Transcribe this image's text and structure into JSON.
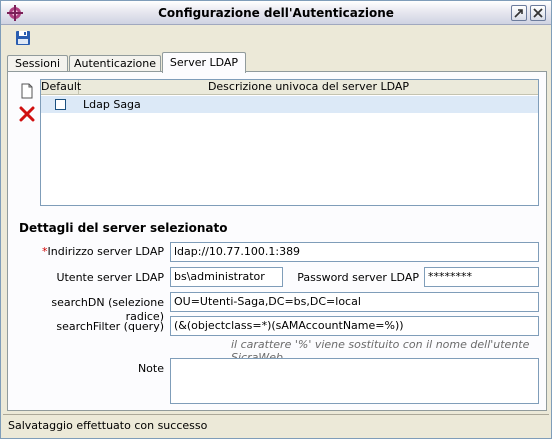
{
  "window": {
    "title": "Configurazione dell'Autenticazione"
  },
  "tabs": [
    {
      "label": "Sessioni"
    },
    {
      "label": "Autenticazione"
    },
    {
      "label": "Server LDAP",
      "active": true
    }
  ],
  "grid": {
    "columns": [
      "Default",
      "Descrizione univoca del server LDAP"
    ],
    "rows": [
      {
        "default": false,
        "description": "Ldap Saga"
      }
    ]
  },
  "details": {
    "title": "Dettagli del server selezionato",
    "required_mark": "*",
    "address_label": "Indirizzo server LDAP",
    "address_value": "ldap://10.77.100.1:389",
    "user_label": "Utente server LDAP",
    "user_value": "bs\\administrator",
    "password_label": "Password server LDAP",
    "password_value": "********",
    "searchdn_label": "searchDN (selezione radice)",
    "searchdn_value": "OU=Utenti-Saga,DC=bs,DC=local",
    "searchfilter_label": "searchFilter (query)",
    "searchfilter_value": "(&(objectclass=*)(sAMAccountName=%))",
    "hint": "il carattere '%' viene sostituito con il nome dell'utente SicraWeb",
    "notes_label": "Note",
    "notes_value": ""
  },
  "status": {
    "text": "Salvataggio effettuato con successo"
  },
  "icons": {
    "app": "app-icon",
    "save": "floppy-disk-icon",
    "new": "new-document-icon",
    "delete": "red-x-icon",
    "restore": "restore-window-icon",
    "close": "close-icon"
  },
  "colors": {
    "selected_row": "#dce9f7",
    "required": "#d00000",
    "delete_icon": "#d01010"
  }
}
